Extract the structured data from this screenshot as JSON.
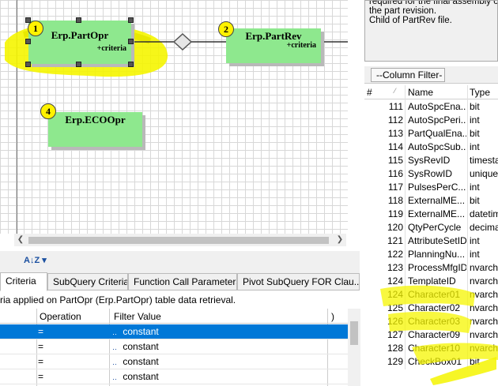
{
  "diagram": {
    "entities": [
      {
        "badge": "1",
        "name": "Erp.PartOpr",
        "criteria": "+criteria"
      },
      {
        "badge": "2",
        "name": "Erp.PartRev",
        "criteria": "+criteria"
      },
      {
        "badge": "4",
        "name": "Erp.ECOOpr",
        "criteria": ""
      }
    ],
    "entity_color": "#8ee88e",
    "badge_color": "#fff200",
    "highlight_color": "#f5f500"
  },
  "info": {
    "lines": [
      "required for the final assembly of",
      "the part revision.",
      "Child of PartRev file."
    ]
  },
  "column_filter": {
    "label": "--Column Filter--"
  },
  "grid": {
    "headers": {
      "num": "#",
      "sort": "⁄",
      "name": "Name",
      "type": "Type"
    },
    "rows": [
      {
        "num": "111",
        "name": "AutoSpcEna...",
        "type": "bit"
      },
      {
        "num": "112",
        "name": "AutoSpcPeri...",
        "type": "int"
      },
      {
        "num": "113",
        "name": "PartQualEna...",
        "type": "bit"
      },
      {
        "num": "114",
        "name": "AutoSpcSub...",
        "type": "int"
      },
      {
        "num": "115",
        "name": "SysRevID",
        "type": "timesta"
      },
      {
        "num": "116",
        "name": "SysRowID",
        "type": "unique"
      },
      {
        "num": "117",
        "name": "PulsesPerC...",
        "type": "int"
      },
      {
        "num": "118",
        "name": "ExternalME...",
        "type": "bit"
      },
      {
        "num": "119",
        "name": "ExternalME...",
        "type": "datetim"
      },
      {
        "num": "120",
        "name": "QtyPerCycle",
        "type": "decima"
      },
      {
        "num": "121",
        "name": "AttributeSetID",
        "type": "int"
      },
      {
        "num": "122",
        "name": "PlanningNu...",
        "type": "int"
      },
      {
        "num": "123",
        "name": "ProcessMfgID",
        "type": "nvarch"
      },
      {
        "num": "124",
        "name": "TemplateID",
        "type": "nvarch"
      },
      {
        "num": "124",
        "name": "Character01",
        "type": "nvarch"
      },
      {
        "num": "125",
        "name": "Character02",
        "type": "nvarch"
      },
      {
        "num": "126",
        "name": "Character03",
        "type": "nvarch"
      },
      {
        "num": "127",
        "name": "Character09",
        "type": "nvarch"
      },
      {
        "num": "128",
        "name": "Character10",
        "type": "nvarch"
      },
      {
        "num": "129",
        "name": "CheckBox01",
        "type": "bit"
      }
    ]
  },
  "tabs": [
    {
      "label": "Criteria",
      "active": true
    },
    {
      "label": "SubQuery Criteria",
      "active": false
    },
    {
      "label": "Function Call Parameters",
      "active": false
    },
    {
      "label": "Pivot SubQuery FOR Clau...",
      "active": false
    }
  ],
  "criteria_description": "ria applied on PartOpr (Erp.PartOpr)  table data retrieval.",
  "criteria_table": {
    "headers": {
      "operation": "Operation",
      "filter_value": "Filter Value",
      "paren": ")"
    },
    "rows": [
      {
        "operation": "=",
        "icon": "constant-icon",
        "value": "constant",
        "selected": true
      },
      {
        "operation": "=",
        "icon": "constant-icon",
        "value": "constant",
        "selected": false
      },
      {
        "operation": "=",
        "icon": "constant-icon",
        "value": "constant",
        "selected": false
      },
      {
        "operation": "=",
        "icon": "constant-icon",
        "value": "constant",
        "selected": false
      }
    ]
  }
}
